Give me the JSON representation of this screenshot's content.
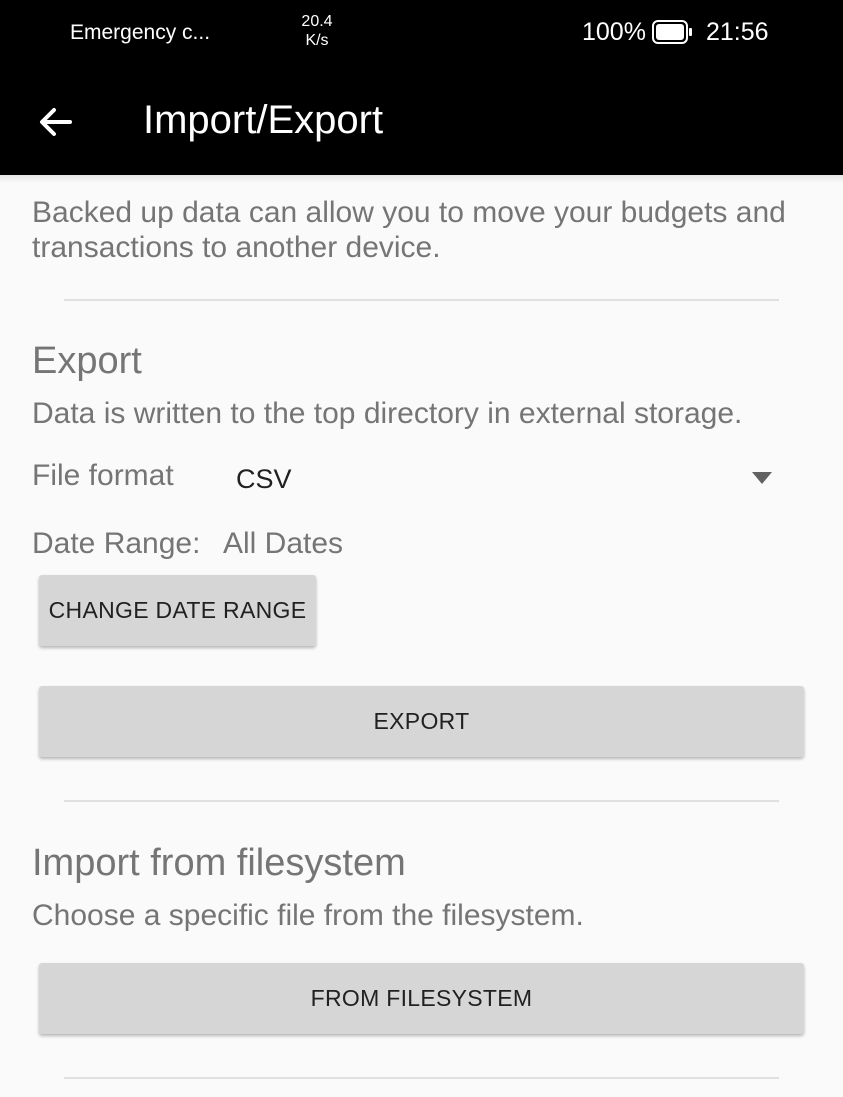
{
  "status_bar": {
    "carrier": "Emergency c...",
    "speed_value": "20.4",
    "speed_unit": "K/s",
    "battery_percent": "100%",
    "time": "21:56"
  },
  "app_bar": {
    "title": "Import/Export"
  },
  "intro_text": "Backed up data can allow you to move your budgets and transactions to another device.",
  "export": {
    "title": "Export",
    "description": "Data is written to the top directory in external storage.",
    "file_format_label": "File format",
    "file_format_value": "CSV",
    "date_range_label": "Date Range:",
    "date_range_value": "All Dates",
    "change_date_range_button": "CHANGE DATE RANGE",
    "export_button": "EXPORT"
  },
  "import_filesystem": {
    "title": "Import from filesystem",
    "description": "Choose a specific file from the filesystem.",
    "button": "FROM FILESYSTEM"
  },
  "colors": {
    "app_bar_background": "#000000",
    "button_background": "#d6d6d6",
    "secondary_text": "#757575"
  }
}
